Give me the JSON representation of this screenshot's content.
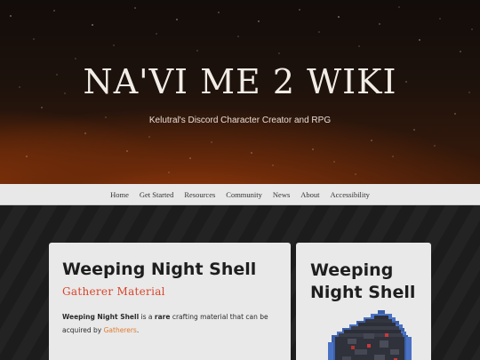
{
  "header": {
    "title": "NA'VI ME 2 WIKI",
    "tagline": "Kelutral's Discord Character Creator and RPG"
  },
  "nav": {
    "items": [
      "Home",
      "Get Started",
      "Resources",
      "Community",
      "News",
      "About",
      "Accessibility"
    ]
  },
  "article": {
    "title": "Weeping Night Shell",
    "category": "Gatherer Material",
    "intro": {
      "subject": "Weeping Night Shell",
      "text_1": " is a ",
      "rarity": "rare",
      "text_2": " crafting material that can be acquired by ",
      "link": "Gatherers",
      "text_3": "."
    }
  },
  "infobox": {
    "title": "Weeping Night Shell",
    "image_icon": "shell-item-icon"
  },
  "colors": {
    "accent_red": "#d9452b",
    "link_orange": "#e07a2e",
    "card_bg": "#e9e9e9",
    "nav_bg": "#e8e8e8"
  }
}
